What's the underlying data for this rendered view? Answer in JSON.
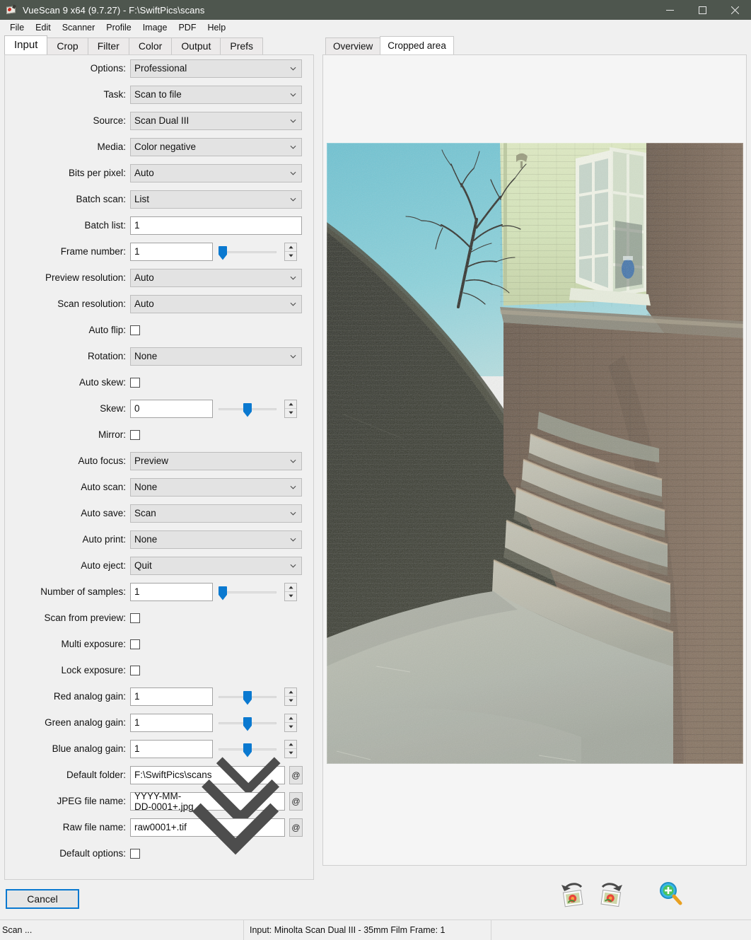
{
  "window": {
    "title": "VueScan 9 x64 (9.7.27) - F:\\SwiftPics\\scans",
    "icon": "vuescan-icon",
    "minimize": "—",
    "maximize": "□",
    "close": "✕"
  },
  "menubar": {
    "items": [
      "File",
      "Edit",
      "Scanner",
      "Profile",
      "Image",
      "PDF",
      "Help"
    ]
  },
  "tabs": {
    "items": [
      "Input",
      "Crop",
      "Filter",
      "Color",
      "Output",
      "Prefs"
    ],
    "active": "Input"
  },
  "form": {
    "rows": [
      {
        "label": "Options:",
        "type": "combo",
        "value": "Professional"
      },
      {
        "label": "Task:",
        "type": "combo",
        "value": "Scan to file"
      },
      {
        "label": "Source:",
        "type": "combo",
        "value": "Scan Dual III"
      },
      {
        "label": "Media:",
        "type": "combo",
        "value": "Color negative"
      },
      {
        "label": "Bits per pixel:",
        "type": "combo",
        "value": "Auto"
      },
      {
        "label": "Batch scan:",
        "type": "combo",
        "value": "List"
      },
      {
        "label": "Batch list:",
        "type": "text",
        "value": "1"
      },
      {
        "label": "Frame number:",
        "type": "slider",
        "value": "1",
        "pos": 0
      },
      {
        "label": "Preview resolution:",
        "type": "combo",
        "value": "Auto"
      },
      {
        "label": "Scan resolution:",
        "type": "combo",
        "value": "Auto"
      },
      {
        "label": "Auto flip:",
        "type": "checkbox",
        "value": "",
        "checked": false
      },
      {
        "label": "Rotation:",
        "type": "combo",
        "value": "None"
      },
      {
        "label": "Auto skew:",
        "type": "checkbox",
        "value": "",
        "checked": false
      },
      {
        "label": "Skew:",
        "type": "slider",
        "value": "0",
        "pos": 50
      },
      {
        "label": "Mirror:",
        "type": "checkbox",
        "value": "",
        "checked": false
      },
      {
        "label": "Auto focus:",
        "type": "combo",
        "value": "Preview"
      },
      {
        "label": "Auto scan:",
        "type": "combo",
        "value": "None"
      },
      {
        "label": "Auto save:",
        "type": "combo",
        "value": "Scan"
      },
      {
        "label": "Auto print:",
        "type": "combo",
        "value": "None"
      },
      {
        "label": "Auto eject:",
        "type": "combo",
        "value": "Quit"
      },
      {
        "label": "Number of samples:",
        "type": "slider",
        "value": "1",
        "pos": 0
      },
      {
        "label": "Scan from preview:",
        "type": "checkbox",
        "value": "",
        "checked": false
      },
      {
        "label": "Multi exposure:",
        "type": "checkbox",
        "value": "",
        "checked": false
      },
      {
        "label": "Lock exposure:",
        "type": "checkbox",
        "value": "",
        "checked": false
      },
      {
        "label": "Red analog gain:",
        "type": "slider",
        "value": "1",
        "pos": 50
      },
      {
        "label": "Green analog gain:",
        "type": "slider",
        "value": "1",
        "pos": 50
      },
      {
        "label": "Blue analog gain:",
        "type": "slider",
        "value": "1",
        "pos": 50
      },
      {
        "label": "Default folder:",
        "type": "pathcombo",
        "value": "F:\\SwiftPics\\scans",
        "at": "@"
      },
      {
        "label": "JPEG file name:",
        "type": "pathcombo",
        "value": "YYYY-MM-DD-0001+.jpg",
        "at": "@"
      },
      {
        "label": "Raw file name:",
        "type": "pathcombo",
        "value": "raw0001+.tif",
        "at": "@"
      },
      {
        "label": "Default options:",
        "type": "checkbox",
        "value": "",
        "checked": false
      }
    ],
    "cancel_label": "Cancel"
  },
  "preview": {
    "tabs": [
      "Overview",
      "Cropped area"
    ],
    "active": "Cropped area",
    "image_description": "Scanned 35mm color negative: curved brick stairwell with stone steps, brick wall, open white sash window, bare trees and cyan sky",
    "toolbar": [
      {
        "name": "rotate-left-icon",
        "label": "Rotate left"
      },
      {
        "name": "rotate-right-icon",
        "label": "Rotate right"
      },
      {
        "name": "zoom-in-icon",
        "label": "Zoom in"
      }
    ]
  },
  "statusbar": {
    "left": "Scan ...",
    "middle": "Input: Minolta Scan Dual III - 35mm Film Frame: 1"
  },
  "colors": {
    "titlebar": "#4e564e",
    "accent": "#0a79d0",
    "panel": "#f0f0f0",
    "combo": "#e3e3e3"
  }
}
